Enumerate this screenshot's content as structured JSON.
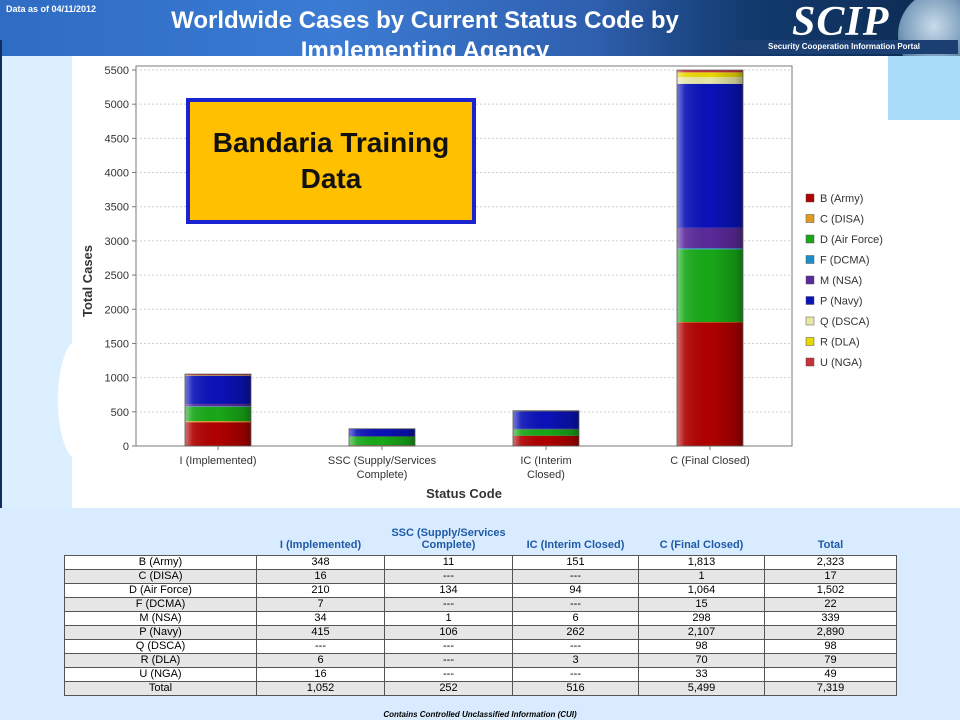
{
  "header": {
    "date_label": "Data as of 04/11/2012",
    "title": "Worldwide Cases by Current Status Code by Implementing Agency",
    "logo_text": "SCIP",
    "logo_tagline": "Security Cooperation Information Portal"
  },
  "watermark": {
    "text": "Bandaria Training Data"
  },
  "footer_note": "Contains Controlled Unclassified Information (CUI)",
  "chart_data": {
    "type": "bar",
    "stacked": true,
    "title": "",
    "xlabel": "Status Code",
    "ylabel": "Total Cases",
    "ylim": [
      0,
      5500
    ],
    "yticks": [
      0,
      500,
      1000,
      1500,
      2000,
      2500,
      3000,
      3500,
      4000,
      4500,
      5000,
      5500
    ],
    "grid": true,
    "legend_position": "right",
    "categories": [
      "I (Implemented)",
      "SSC (Supply/Services Complete)",
      "IC (Interim Closed)",
      "C (Final Closed)"
    ],
    "series": [
      {
        "name": "B (Army)",
        "color": "#b00000",
        "values": [
          348,
          11,
          151,
          1813
        ]
      },
      {
        "name": "C (DISA)",
        "color": "#e39a1c",
        "values": [
          16,
          0,
          0,
          1
        ]
      },
      {
        "name": "D (Air Force)",
        "color": "#18a818",
        "values": [
          210,
          134,
          94,
          1064
        ]
      },
      {
        "name": "F (DCMA)",
        "color": "#1a8fc9",
        "values": [
          7,
          0,
          0,
          15
        ]
      },
      {
        "name": "M (NSA)",
        "color": "#5a2a9a",
        "values": [
          34,
          1,
          6,
          298
        ]
      },
      {
        "name": "P (Navy)",
        "color": "#0a12b8",
        "values": [
          415,
          106,
          262,
          2107
        ]
      },
      {
        "name": "Q (DSCA)",
        "color": "#e8e7a6",
        "values": [
          0,
          0,
          0,
          98
        ]
      },
      {
        "name": "R (DLA)",
        "color": "#e8d800",
        "values": [
          6,
          0,
          3,
          70
        ]
      },
      {
        "name": "U (NGA)",
        "color": "#c8303a",
        "values": [
          16,
          0,
          0,
          33
        ]
      }
    ]
  },
  "table": {
    "headers": [
      "",
      "I (Implemented)",
      "SSC (Supply/Services Complete)",
      "IC (Interim Closed)",
      "C (Final Closed)",
      "Total"
    ],
    "rows": [
      [
        "B (Army)",
        "348",
        "11",
        "151",
        "1,813",
        "2,323"
      ],
      [
        "C (DISA)",
        "16",
        "---",
        "---",
        "1",
        "17"
      ],
      [
        "D (Air Force)",
        "210",
        "134",
        "94",
        "1,064",
        "1,502"
      ],
      [
        "F (DCMA)",
        "7",
        "---",
        "---",
        "15",
        "22"
      ],
      [
        "M (NSA)",
        "34",
        "1",
        "6",
        "298",
        "339"
      ],
      [
        "P (Navy)",
        "415",
        "106",
        "262",
        "2,107",
        "2,890"
      ],
      [
        "Q (DSCA)",
        "---",
        "---",
        "---",
        "98",
        "98"
      ],
      [
        "R (DLA)",
        "6",
        "---",
        "3",
        "70",
        "79"
      ],
      [
        "U (NGA)",
        "16",
        "---",
        "---",
        "33",
        "49"
      ],
      [
        "Total",
        "1,052",
        "252",
        "516",
        "5,499",
        "7,319"
      ]
    ]
  }
}
